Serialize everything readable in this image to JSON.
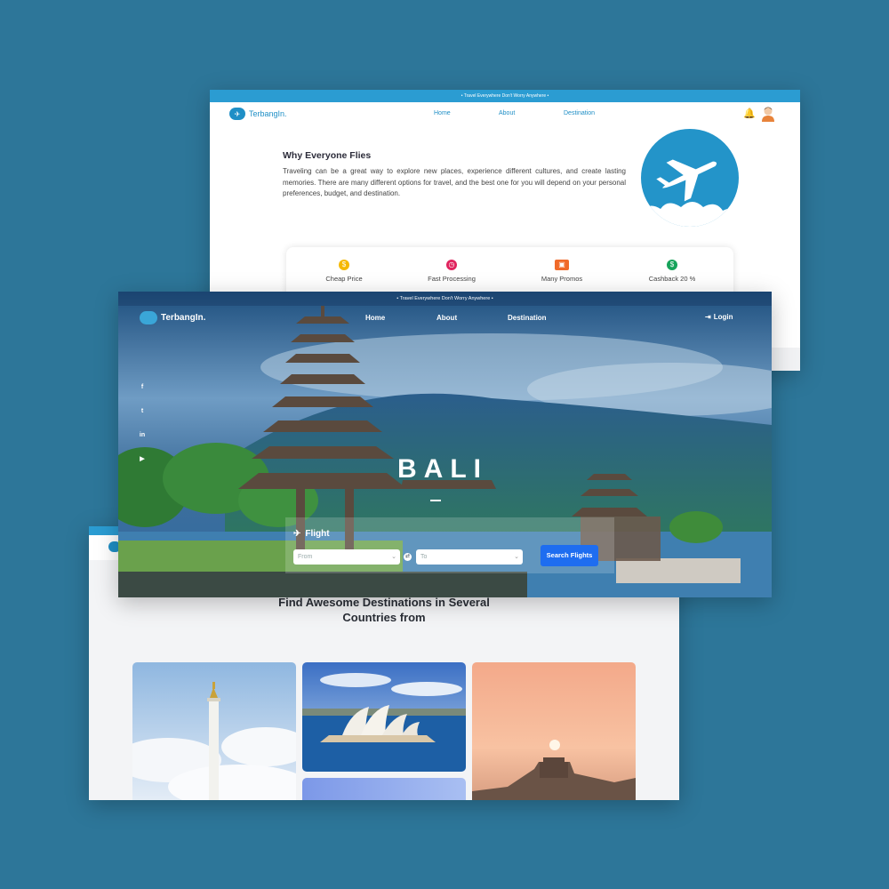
{
  "back_screen": {
    "tagline": "• Travel Everywhere Don't Worry Anywhere •",
    "logo_text": "TerbangIn.",
    "nav": [
      "Home",
      "About",
      "Destination"
    ],
    "why_title": "Why Everyone Flies",
    "why_text": "Traveling can be a great way to explore new places, experience different cultures, and create lasting memories. There are many different options for travel, and the best one for you will depend on your personal preferences, budget, and destination.",
    "features": [
      {
        "label": "Cheap Price",
        "icon": "coin-icon",
        "color": "#f5b800"
      },
      {
        "label": "Fast Processing",
        "icon": "stopwatch-icon",
        "color": "#e0245e"
      },
      {
        "label": "Many Promos",
        "icon": "gift-icon",
        "color": "#f06a2a"
      },
      {
        "label": "Cashback 20 %",
        "icon": "cashback-icon",
        "color": "#17a35b"
      }
    ]
  },
  "front_screen": {
    "tagline": "• Travel Everywhere Don't Worry Anywhere •",
    "logo_text": "TerbangIn.",
    "nav": [
      "Home",
      "About",
      "Destination"
    ],
    "login_label": "Login",
    "hero_title": "BALI",
    "flight_label": "Flight",
    "from_placeholder": "From",
    "to_placeholder": "To",
    "search_button": "Search Flights",
    "social_icons": [
      "facebook-icon",
      "twitter-icon",
      "linkedin-icon",
      "youtube-icon"
    ]
  },
  "bottom_screen": {
    "heading_line1": "Find Awesome Destinations in Several",
    "heading_line2": "Countries from"
  },
  "colors": {
    "background": "#2d7699",
    "brand": "#1f8fc6",
    "search_button": "#1e6df0"
  }
}
